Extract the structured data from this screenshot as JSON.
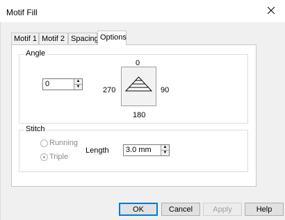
{
  "window": {
    "title": "Motif Fill"
  },
  "tabs": [
    "Motif 1",
    "Motif 2",
    "Spacing",
    "Options"
  ],
  "angle": {
    "label": "Angle",
    "value": "0",
    "compass": {
      "top": "0",
      "left": "270",
      "right": "90",
      "bottom": "180"
    }
  },
  "stitch": {
    "label": "Stitch",
    "options": [
      "Running",
      "Triple"
    ],
    "selected": "Triple",
    "length_label": "Length",
    "length_value": "3.0 mm"
  },
  "buttons": {
    "ok": "OK",
    "cancel": "Cancel",
    "apply": "Apply",
    "help": "Help"
  },
  "icons": {
    "close": "close-icon",
    "compass_motif": "triangle-fill-icon",
    "spin_up": "chevron-up-icon",
    "spin_down": "chevron-down-icon"
  },
  "colors": {
    "default_button_border": "#0078d7",
    "dialog_background": "#f0f0f0"
  }
}
